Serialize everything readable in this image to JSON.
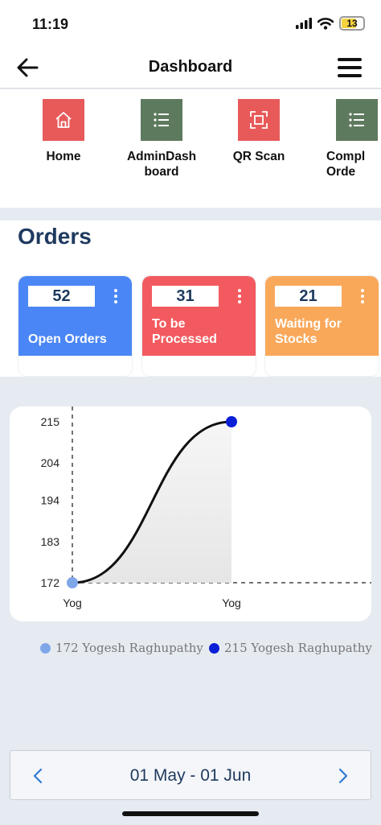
{
  "status_bar": {
    "time": "11:19",
    "battery_level": "13"
  },
  "header": {
    "title": "Dashboard"
  },
  "shortcuts": [
    {
      "label": "Home",
      "icon": "home-icon",
      "color": "#e85a5a"
    },
    {
      "label": "AdminDash board",
      "icon": "list-icon",
      "color": "#5e7a5e"
    },
    {
      "label": "QR Scan",
      "icon": "qr-scan-icon",
      "color": "#e85a5a"
    },
    {
      "label": "Compl Orde",
      "icon": "list-icon",
      "color": "#5e7a5e"
    }
  ],
  "orders": {
    "title": "Orders",
    "cards": [
      {
        "count": "52",
        "label": "Open Orders",
        "color": "#4a86f5"
      },
      {
        "count": "31",
        "label": "To be Processed",
        "color": "#f25a5f"
      },
      {
        "count": "21",
        "label": "Waiting for Stocks",
        "color": "#f9a85a"
      }
    ]
  },
  "chart_data": {
    "type": "line",
    "categories": [
      "Yog",
      "Yog"
    ],
    "values": [
      172,
      215
    ],
    "y_ticks": [
      "215",
      "204",
      "194",
      "183",
      "172"
    ],
    "ylim": [
      172,
      215
    ],
    "grid": false,
    "legend": [
      {
        "label": "172 Yogesh Raghupathy",
        "color": "#7fa7e8"
      },
      {
        "label": "215 Yogesh Raghupathy",
        "color": "#0a1fd6"
      }
    ]
  },
  "date_range": {
    "label": "01 May - 01 Jun"
  }
}
